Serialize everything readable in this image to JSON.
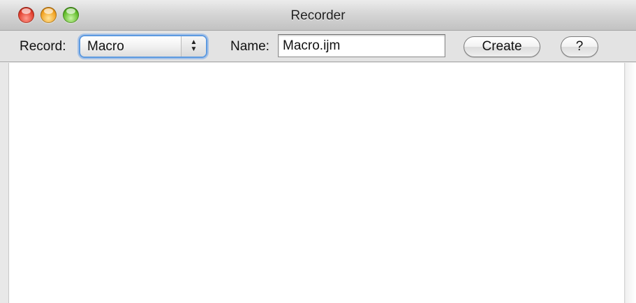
{
  "window": {
    "title": "Recorder"
  },
  "toolbar": {
    "record_label": "Record:",
    "record_select": {
      "selected": "Macro",
      "arrows_glyph": "▲\n▼"
    },
    "name_label": "Name:",
    "name_input": {
      "value": "Macro.ijm"
    },
    "create_label": "Create",
    "help_label": "?"
  },
  "content": {
    "text": ""
  },
  "colors": {
    "select_focus_ring": "#5d9ae0",
    "close": "#e2402f",
    "minimize": "#f2a323",
    "zoom": "#63bd2c"
  },
  "icons": {
    "close": "close-icon",
    "minimize": "minimize-icon",
    "zoom": "zoom-icon",
    "select_arrows": "up-down-arrows-icon"
  }
}
